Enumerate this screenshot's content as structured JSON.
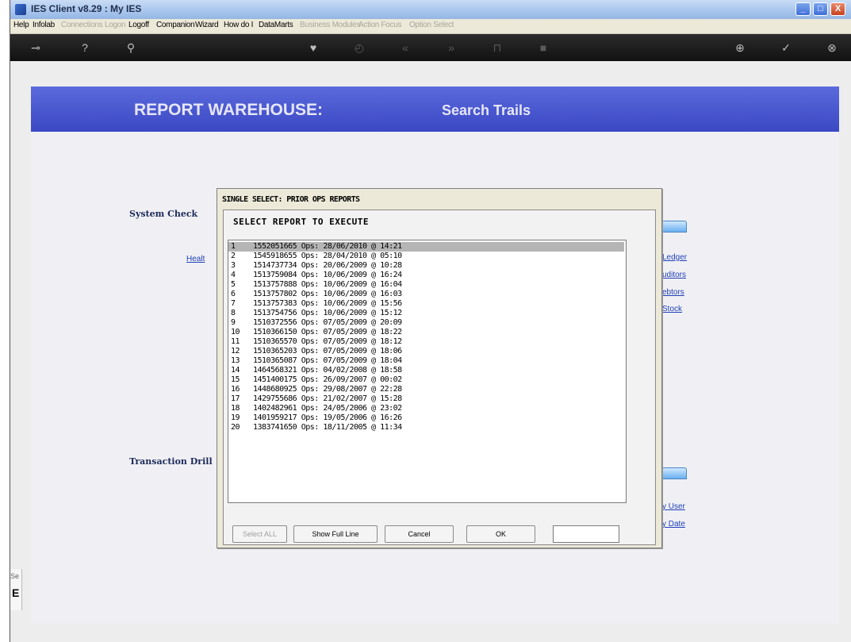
{
  "window": {
    "title": "IES Client v8.29 : My IES",
    "controls": {
      "minimize": "_",
      "maximize": "□",
      "close": "X"
    }
  },
  "menu": [
    {
      "label": "Help",
      "enabled": true
    },
    {
      "label": "Infolab",
      "enabled": true
    },
    {
      "label": "Connections",
      "enabled": false
    },
    {
      "label": "Logon",
      "enabled": false
    },
    {
      "label": "Logoff",
      "enabled": true
    },
    {
      "label": "Companion",
      "enabled": true
    },
    {
      "label": "Wizard",
      "enabled": true
    },
    {
      "label": "How do I",
      "enabled": true
    },
    {
      "label": "DataMarts",
      "enabled": true
    },
    {
      "label": "Business Modules",
      "enabled": false
    },
    {
      "label": "Action Focus",
      "enabled": false
    },
    {
      "label": "Option Select",
      "enabled": false
    }
  ],
  "toolbar": [
    {
      "name": "key-icon",
      "glyph": "⊸",
      "enabled": true
    },
    {
      "name": "help-icon",
      "glyph": "?",
      "enabled": true
    },
    {
      "name": "search-icon",
      "glyph": "⚲",
      "enabled": true
    },
    {
      "name": "heart-icon",
      "glyph": "♥",
      "enabled": true
    },
    {
      "name": "clock-icon",
      "glyph": "◴",
      "enabled": false
    },
    {
      "name": "rewind-icon",
      "glyph": "«",
      "enabled": false
    },
    {
      "name": "forward-icon",
      "glyph": "»",
      "enabled": false
    },
    {
      "name": "pin-icon",
      "glyph": "⊓",
      "enabled": false
    },
    {
      "name": "stop-icon",
      "glyph": "■",
      "enabled": false
    },
    {
      "name": "plus-icon",
      "glyph": "⊕",
      "enabled": true
    },
    {
      "name": "check-icon",
      "glyph": "✓",
      "enabled": true
    },
    {
      "name": "close-icon",
      "glyph": "⊗",
      "enabled": true
    }
  ],
  "banner": {
    "left": "REPORT WAREHOUSE:",
    "right": "Search Trails"
  },
  "sections": {
    "system_check": "System Check",
    "transaction_drill": "Transaction Drill"
  },
  "links": {
    "health": "Healt",
    "ledger": "Ledger",
    "creditors": "uditors",
    "debtors": "ebtors",
    "stock": "Stock",
    "by_user": "y User",
    "by_date": "y Date"
  },
  "side_strip": {
    "text": "Se",
    "big": "E"
  },
  "dialog": {
    "title": "SINGLE SELECT: PRIOR OPS REPORTS",
    "heading": "SELECT REPORT TO EXECUTE",
    "selected_index": 0,
    "rows": [
      {
        "num": "1",
        "text": "1552051665 Ops: 28/06/2010 @ 14:21"
      },
      {
        "num": "2",
        "text": "1545918655 Ops: 28/04/2010 @ 05:10"
      },
      {
        "num": "3",
        "text": "1514737734 Ops: 20/06/2009 @ 10:28"
      },
      {
        "num": "4",
        "text": "1513759084 Ops: 10/06/2009 @ 16:24"
      },
      {
        "num": "5",
        "text": "1513757888 Ops: 10/06/2009 @ 16:04"
      },
      {
        "num": "6",
        "text": "1513757802 Ops: 10/06/2009 @ 16:03"
      },
      {
        "num": "7",
        "text": "1513757383 Ops: 10/06/2009 @ 15:56"
      },
      {
        "num": "8",
        "text": "1513754756 Ops: 10/06/2009 @ 15:12"
      },
      {
        "num": "9",
        "text": "1510372556 Ops: 07/05/2009 @ 20:09"
      },
      {
        "num": "10",
        "text": "1510366150 Ops: 07/05/2009 @ 18:22"
      },
      {
        "num": "11",
        "text": "1510365570 Ops: 07/05/2009 @ 18:12"
      },
      {
        "num": "12",
        "text": "1510365203 Ops: 07/05/2009 @ 18:06"
      },
      {
        "num": "13",
        "text": "1510365087 Ops: 07/05/2009 @ 18:04"
      },
      {
        "num": "14",
        "text": "1464568321 Ops: 04/02/2008 @ 18:58"
      },
      {
        "num": "15",
        "text": "1451400175 Ops: 26/09/2007 @ 00:02"
      },
      {
        "num": "16",
        "text": "1448680925 Ops: 29/08/2007 @ 22:28"
      },
      {
        "num": "17",
        "text": "1429755686 Ops: 21/02/2007 @ 15:28"
      },
      {
        "num": "18",
        "text": "1402482961 Ops: 24/05/2006 @ 23:02"
      },
      {
        "num": "19",
        "text": "1401959217 Ops: 19/05/2006 @ 16:26"
      },
      {
        "num": "20",
        "text": "1383741650 Ops: 18/11/2005 @ 11:34"
      }
    ],
    "buttons": {
      "select_all": "Select ALL",
      "show_full_line": "Show Full Line",
      "cancel": "Cancel",
      "ok": "OK"
    }
  }
}
